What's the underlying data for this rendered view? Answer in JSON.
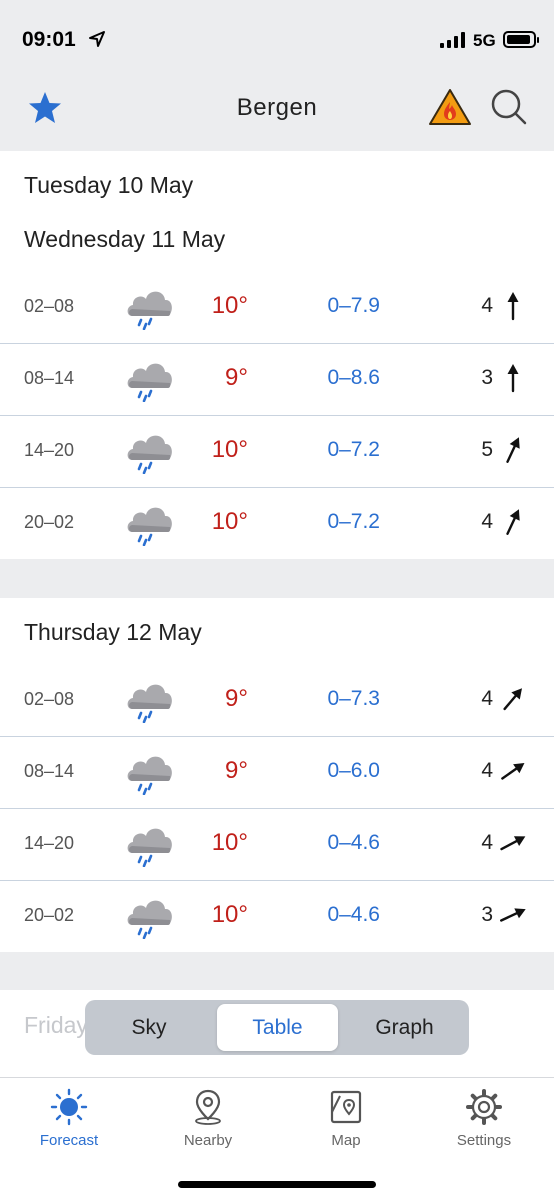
{
  "status_bar": {
    "time": "09:01",
    "network": "5G"
  },
  "header": {
    "title": "Bergen",
    "favorite_icon": "star-icon",
    "warning_icon": "forest-fire-warning-icon",
    "search_icon": "search-icon"
  },
  "days": [
    {
      "title": "Tuesday 10 May"
    },
    {
      "title": "Wednesday 11 May",
      "rows": [
        {
          "period": "02–08",
          "icon": "rain-cloud-icon",
          "temp": "10°",
          "precip": "0–7.9",
          "wind": "4",
          "wind_dir_deg": 0
        },
        {
          "period": "08–14",
          "icon": "rain-cloud-icon",
          "temp": "9°",
          "precip": "0–8.6",
          "wind": "3",
          "wind_dir_deg": 0
        },
        {
          "period": "14–20",
          "icon": "rain-cloud-icon",
          "temp": "10°",
          "precip": "0–7.2",
          "wind": "5",
          "wind_dir_deg": 25
        },
        {
          "period": "20–02",
          "icon": "rain-cloud-icon",
          "temp": "10°",
          "precip": "0–7.2",
          "wind": "4",
          "wind_dir_deg": 25
        }
      ]
    },
    {
      "title": "Thursday 12 May",
      "rows": [
        {
          "period": "02–08",
          "icon": "rain-cloud-icon",
          "temp": "9°",
          "precip": "0–7.3",
          "wind": "4",
          "wind_dir_deg": 40
        },
        {
          "period": "08–14",
          "icon": "rain-cloud-icon",
          "temp": "9°",
          "precip": "0–6.0",
          "wind": "4",
          "wind_dir_deg": 55
        },
        {
          "period": "14–20",
          "icon": "rain-cloud-icon",
          "temp": "10°",
          "precip": "0–4.6",
          "wind": "4",
          "wind_dir_deg": 62
        },
        {
          "period": "20–02",
          "icon": "rain-cloud-icon",
          "temp": "10°",
          "precip": "0–4.6",
          "wind": "3",
          "wind_dir_deg": 65
        }
      ]
    },
    {
      "title": "Friday"
    }
  ],
  "view_switch": {
    "options": [
      "Sky",
      "Table",
      "Graph"
    ],
    "selected": "Table"
  },
  "tabs": [
    {
      "label": "Forecast",
      "icon": "sun-icon",
      "active": true
    },
    {
      "label": "Nearby",
      "icon": "location-pin-icon",
      "active": false
    },
    {
      "label": "Map",
      "icon": "map-icon",
      "active": false
    },
    {
      "label": "Settings",
      "icon": "gear-icon",
      "active": false
    }
  ],
  "colors": {
    "accent": "#2b6fd0",
    "temperature": "#c0201a",
    "precipitation": "#2b6fd0",
    "warning": "#f39c12"
  }
}
